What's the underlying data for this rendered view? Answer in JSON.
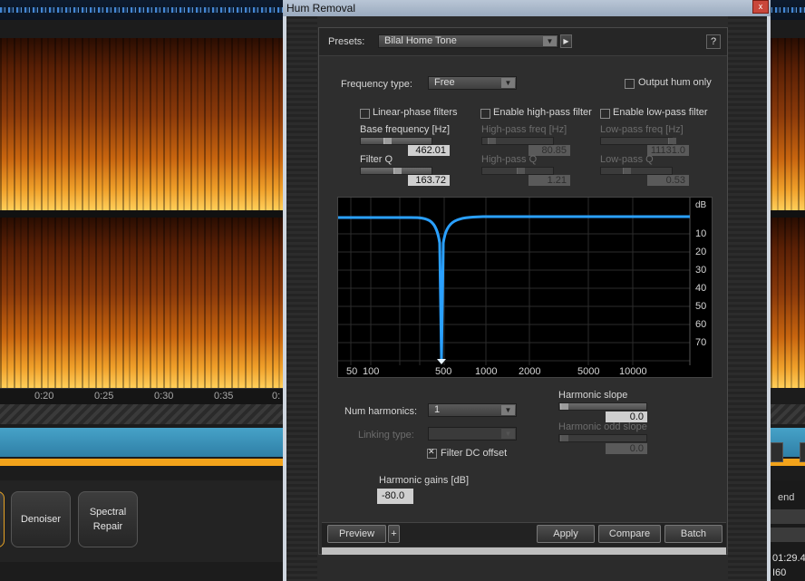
{
  "background": {
    "timeline_ticks": [
      "0:20",
      "0:25",
      "0:30",
      "0:35",
      "0:"
    ],
    "modules": {
      "denoiser": "Denoiser",
      "spectral_line1": "Spectral",
      "spectral_line2": "Repair"
    },
    "right_panel": {
      "end_label": "end",
      "time": "01:29.4",
      "value": "I60"
    }
  },
  "dialog": {
    "title": "Hum Removal",
    "close_glyph": "x",
    "presets": {
      "label": "Presets:",
      "value": "Bilal Home Tone",
      "help": "?"
    },
    "frequency_type": {
      "label": "Frequency type:",
      "value": "Free"
    },
    "output_hum_only": {
      "label": "Output hum only",
      "checked": false
    },
    "linear_phase": {
      "label": "Linear-phase filters",
      "checked": false
    },
    "high_pass": {
      "label": "Enable high-pass filter",
      "checked": false
    },
    "low_pass": {
      "label": "Enable low-pass filter",
      "checked": false
    },
    "base_frequency": {
      "label": "Base frequency [Hz]",
      "value": "462.01",
      "position": 0.3
    },
    "filter_q": {
      "label": "Filter Q",
      "value": "163.72",
      "position": 0.45
    },
    "high_pass_freq": {
      "label": "High-pass freq [Hz]",
      "value": "80.85",
      "position": 0.08
    },
    "high_pass_q": {
      "label": "High-pass Q",
      "value": "1.21",
      "position": 0.5
    },
    "low_pass_freq": {
      "label": "Low-pass freq [Hz]",
      "value": "11131.0",
      "position": 0.9
    },
    "low_pass_q": {
      "label": "Low-pass Q",
      "value": "0.53",
      "position": 0.3
    },
    "graph": {
      "unit": "dB",
      "y_ticks": [
        "10",
        "20",
        "30",
        "40",
        "50",
        "60",
        "70"
      ],
      "x_ticks": [
        "50",
        "100",
        "500",
        "1000",
        "2000",
        "5000",
        "10000"
      ],
      "curve_color": "#2aa0ff",
      "notch_freq_hz": 462
    },
    "num_harmonics": {
      "label": "Num harmonics:",
      "value": "1"
    },
    "linking_type": {
      "label": "Linking type:",
      "value": ""
    },
    "filter_dc": {
      "label": "Filter DC offset",
      "checked": true
    },
    "harmonic_slope": {
      "label": "Harmonic slope",
      "value": "0.0",
      "position": 0.0
    },
    "harmonic_odd_slope": {
      "label": "Harmonic odd slope",
      "value": "0.0",
      "position": 0.0
    },
    "harmonic_gains": {
      "label": "Harmonic gains [dB]",
      "value": "-80.0"
    },
    "buttons": {
      "preview": "Preview",
      "plus": "+",
      "apply": "Apply",
      "compare": "Compare",
      "batch": "Batch"
    }
  }
}
